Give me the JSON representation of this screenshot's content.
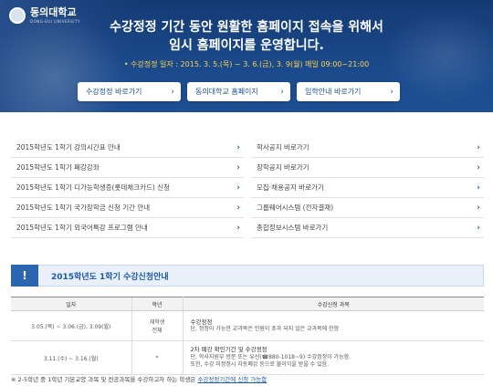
{
  "logo": {
    "name": "동의대학교",
    "sub": "DONG-EUI UNIVERSITY"
  },
  "hero": {
    "title_line1": "수강정정 기간 동안 원활한 홈페이지 접속을 위해서",
    "title_line2": "임시 홈페이지를 운영합니다.",
    "date_text": "• 수강정정 일자 : 2015. 3. 5.(목) ~ 3. 6.(금), 3. 9(월) 매일 09:00~21:00",
    "buttons": [
      {
        "label": "수강정정 바로가기"
      },
      {
        "label": "동의대학교 홈페이지"
      },
      {
        "label": "입학안내 바로가기"
      }
    ]
  },
  "left_links": [
    {
      "label": "2015학년도 1학기 강의시간표 안내"
    },
    {
      "label": "2015학년도 1학기 폐강강좌"
    },
    {
      "label": "2015학년도 1학기 디가능학생증(롯데체크카드) 신청"
    },
    {
      "label": "2015학년도 1학기 국가장학금 신청 기간 안내"
    },
    {
      "label": "2015학년도 1학기 외국어특강 프로그램 안내"
    }
  ],
  "right_links": [
    {
      "label": "학사공지 바로가기"
    },
    {
      "label": "장학공지 바로가기"
    },
    {
      "label": "모집·채용공지 바로가기"
    },
    {
      "label": "그룹웨어시스템 (전자결재)"
    },
    {
      "label": "종합정보시스템 바로가기"
    }
  ],
  "notice": {
    "mark": "!",
    "title": "2015학년도 1학기 수강신청안내"
  },
  "table": {
    "headers": [
      "일자",
      "학년",
      "수강신청 과목"
    ],
    "rows": [
      {
        "date": "3.05.(목) ~ 3.06.(금), 3.09(월)",
        "who1": "재학생",
        "who2": "전체",
        "title": "수강정정",
        "line1": "단, 정정이 가능한 교과목은 인원이 초과 되지 않은 교과목에 한함",
        "line2": ""
      },
      {
        "date": "3.11.(수) ~ 3.16.(월)",
        "who1": "*",
        "who2": "",
        "title": "2차 폐강 확인기간 및 수강정정",
        "line1": "단, 학사지원부 방문 또는 유선(☎880-1018~9) 수강정정이 가능함.",
        "line2": "또한, 수강 미정정시 자동폐강 등으로 불이익을 받을 수 있음."
      }
    ]
  },
  "footnote": {
    "prefix": "※ 2-5학년 중 1학년 기본교양 과목 및 전공과목을 수강하고자 하는 학생은 ",
    "highlight": "수강정정기간에 신청 가능함"
  }
}
